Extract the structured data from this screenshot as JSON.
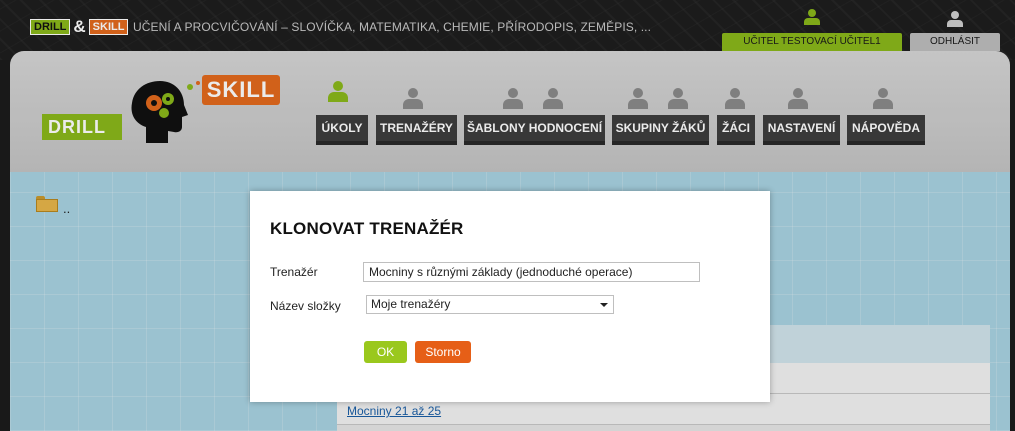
{
  "header": {
    "brand_drill": "DRILL",
    "brand_amp": "&",
    "brand_skill": "SKILL",
    "tagline": "UČENÍ A PROCVIČOVÁNÍ – SLOVÍČKA, MATEMATIKA, CHEMIE, PŘÍRODOPIS, ZEMĚPIS, ...",
    "user_label": "UČITEL TESTOVACÍ UČITEL1",
    "logout_label": "ODHLÁSIT"
  },
  "logo": {
    "drill": "DRILL",
    "skill": "SKILL"
  },
  "nav": [
    {
      "label": "ÚKOLY",
      "active": true
    },
    {
      "label": "TRENAŽÉRY",
      "active": false
    },
    {
      "label": "ŠABLONY HODNOCENÍ",
      "active": false
    },
    {
      "label": "SKUPINY ŽÁKŮ",
      "active": false
    },
    {
      "label": "ŽÁCI",
      "active": false
    },
    {
      "label": "NASTAVENÍ",
      "active": false
    },
    {
      "label": "NÁPOVĚDA",
      "active": false
    }
  ],
  "folder": {
    "label": ".."
  },
  "list": {
    "visible_link": "Mocniny 21 až 25"
  },
  "modal": {
    "title": "KLONOVAT TRENAŽÉR",
    "trainer_label": "Trenažér",
    "trainer_value": "Mocniny s různými základy (jednoduché operace)",
    "folder_label": "Název složky",
    "folder_value": "Moje trenažéry",
    "ok_label": "OK",
    "cancel_label": "Storno"
  },
  "colors": {
    "green": "#8ab81b",
    "orange": "#e36a1d",
    "nav_dark": "#3d3d3d"
  }
}
